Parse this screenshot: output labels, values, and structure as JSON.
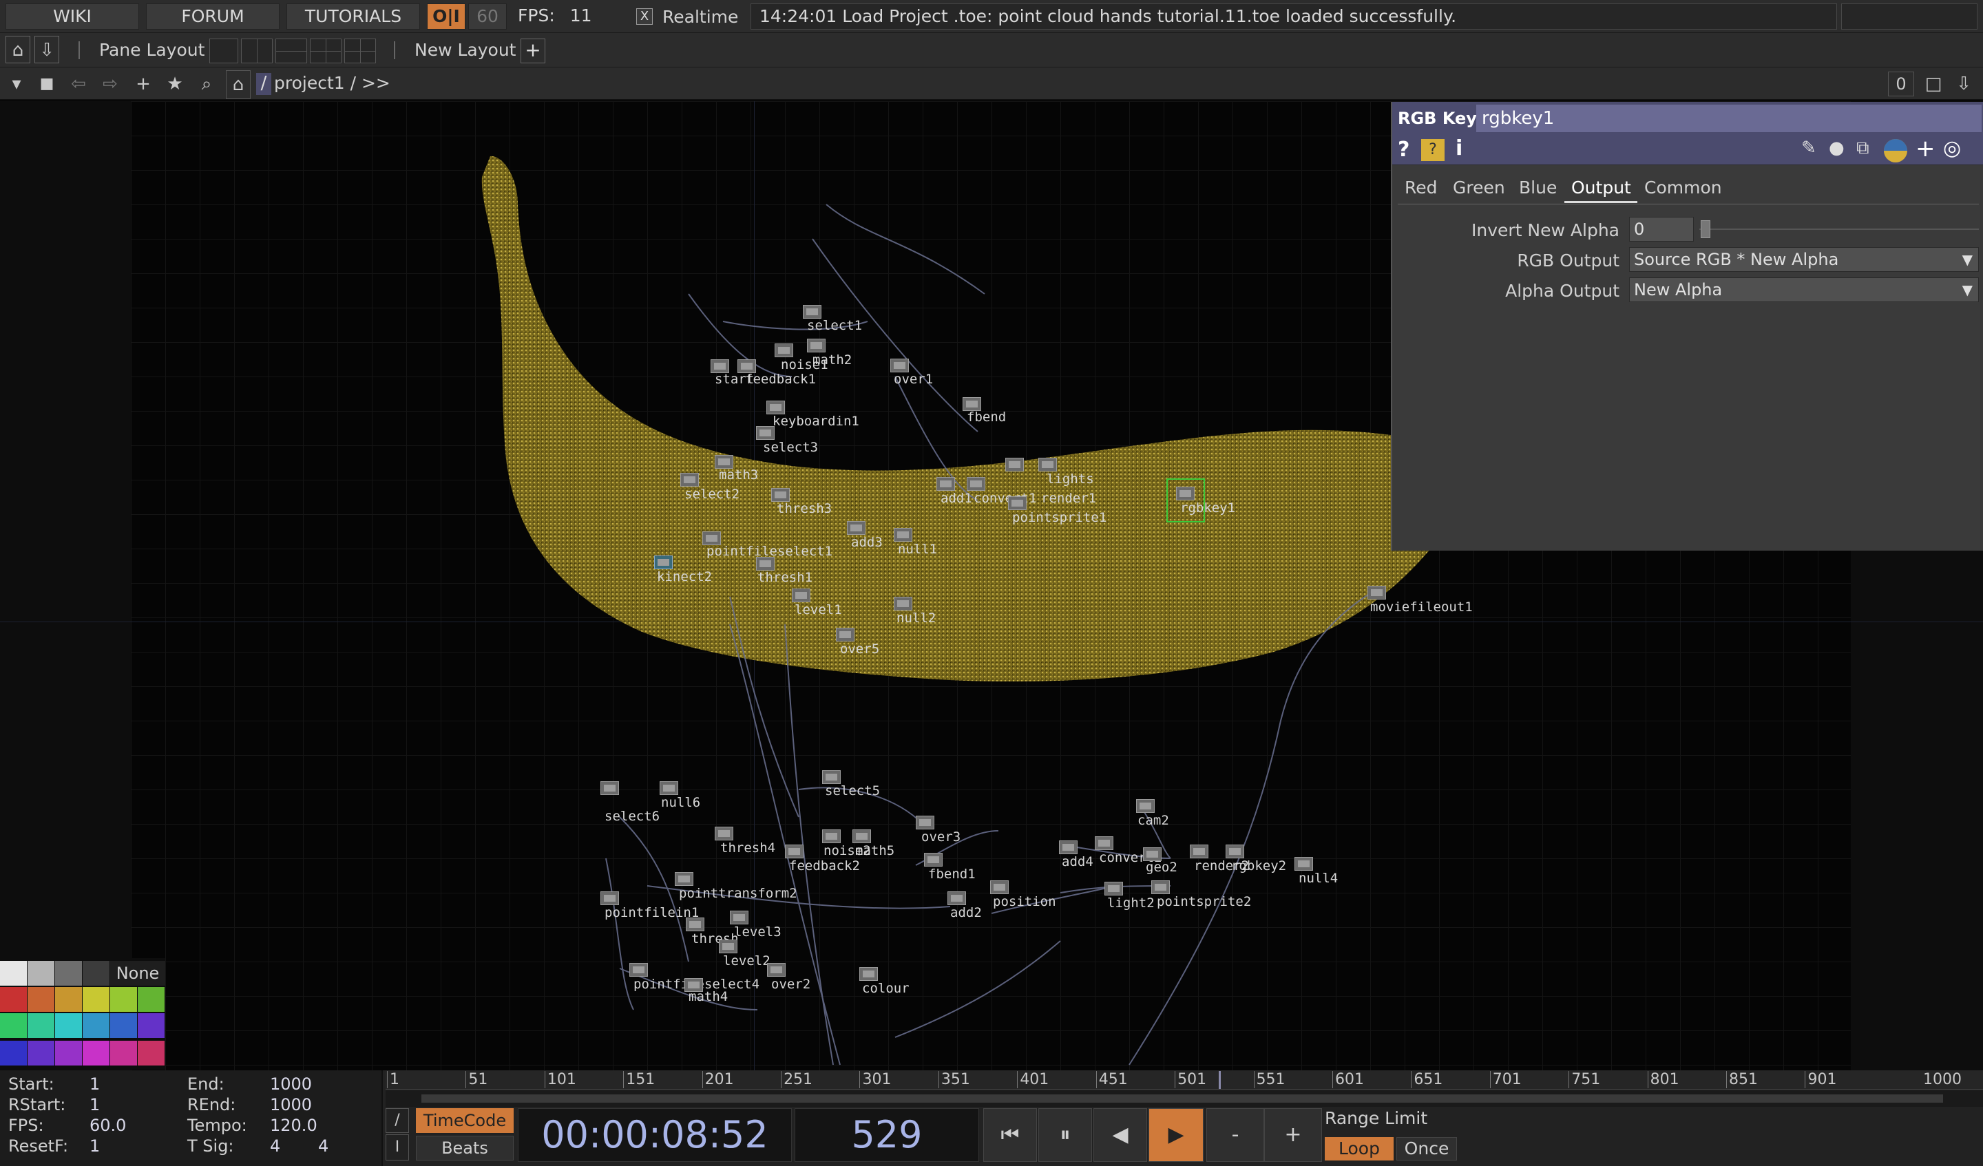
{
  "topbar": {
    "wiki": "WIKI",
    "forum": "FORUM",
    "tutorials": "TUTORIALS",
    "oi": "O|I",
    "sixty": "60",
    "fps_label": "FPS:",
    "fps_value": "11",
    "realtime_check": "X",
    "realtime_label": "Realtime",
    "status": "14:24:01 Load Project .toe: point cloud hands tutorial.11.toe loaded successfully."
  },
  "bar2": {
    "pane_layout": "Pane Layout",
    "new_layout": "New Layout",
    "plus": "+"
  },
  "bar3": {
    "slash": "/",
    "path": "project1 / >>",
    "counter": "0"
  },
  "network": {
    "nodes": [
      {
        "name": "select1"
      },
      {
        "name": "math2"
      },
      {
        "name": "noise1"
      },
      {
        "name": "feedback1"
      },
      {
        "name": "start"
      },
      {
        "name": "over1"
      },
      {
        "name": "fbend"
      },
      {
        "name": "keyboardin1"
      },
      {
        "name": "select3"
      },
      {
        "name": "math3"
      },
      {
        "name": "select2"
      },
      {
        "name": "thresh3"
      },
      {
        "name": "add3"
      },
      {
        "name": "null1"
      },
      {
        "name": "pointfileselect1"
      },
      {
        "name": "thresh1"
      },
      {
        "name": "kinect2"
      },
      {
        "name": "level1"
      },
      {
        "name": "null2"
      },
      {
        "name": "over5"
      },
      {
        "name": "add1"
      },
      {
        "name": "convert1"
      },
      {
        "name": "render1"
      },
      {
        "name": "lights"
      },
      {
        "name": "pointsprite1"
      },
      {
        "name": "rgbkey1"
      },
      {
        "name": "moviefileout1"
      },
      {
        "name": "select5"
      },
      {
        "name": "select6"
      },
      {
        "name": "null6"
      },
      {
        "name": "thresh4"
      },
      {
        "name": "over3"
      },
      {
        "name": "noise2"
      },
      {
        "name": "math5"
      },
      {
        "name": "feedback2"
      },
      {
        "name": "fbend1"
      },
      {
        "name": "pointtransform2"
      },
      {
        "name": "position"
      },
      {
        "name": "add2"
      },
      {
        "name": "pointfilein1"
      },
      {
        "name": "thresh"
      },
      {
        "name": "level3"
      },
      {
        "name": "level2"
      },
      {
        "name": "pointfileselect4"
      },
      {
        "name": "math4"
      },
      {
        "name": "over2"
      },
      {
        "name": "colour"
      },
      {
        "name": "cam2"
      },
      {
        "name": "add4"
      },
      {
        "name": "convert2"
      },
      {
        "name": "geo2"
      },
      {
        "name": "render2"
      },
      {
        "name": "rgbkey2"
      },
      {
        "name": "null4"
      },
      {
        "name": "light2"
      },
      {
        "name": "pointsprite2"
      }
    ]
  },
  "param": {
    "type": "RGB Key",
    "name": "rgbkey1",
    "tabs": [
      "Red",
      "Green",
      "Blue",
      "Output",
      "Common"
    ],
    "active_tab": "Output",
    "invert_label": "Invert New Alpha",
    "invert_value": "0",
    "rgb_output_label": "RGB Output",
    "rgb_output_value": "Source RGB * New Alpha",
    "alpha_output_label": "Alpha Output",
    "alpha_output_value": "New Alpha",
    "icons": [
      "help-icon",
      "python-help-icon",
      "info-icon",
      "pencil-icon",
      "comment-icon",
      "clone-icon",
      "python-icon",
      "plus-icon",
      "target-icon"
    ]
  },
  "palette": {
    "none_label": "None",
    "rows": [
      [
        "#e6e6e6",
        "#b4b4b4",
        "#6e6e6e",
        "#3c3c3c"
      ],
      [
        "#c83232",
        "#c86432",
        "#c8962f",
        "#c8c832",
        "#96c832",
        "#64b432"
      ],
      [
        "#32c864",
        "#32c896",
        "#32c8c8",
        "#3296c8",
        "#3264c8",
        "#6432c8"
      ],
      [
        "#3232c8",
        "#6432c8",
        "#9632c8",
        "#c832c8",
        "#c83296",
        "#c83264"
      ]
    ]
  },
  "timeline": {
    "start_label": "Start:",
    "start": "1",
    "rstart_label": "RStart:",
    "rstart": "1",
    "fps_label": "FPS:",
    "fps": "60.0",
    "resetf_label": "ResetF:",
    "resetf": "1",
    "end_label": "End:",
    "end": "1000",
    "rend_label": "REnd:",
    "rend": "1000",
    "tempo_label": "Tempo:",
    "tempo": "120.0",
    "tsig_label": "T Sig:",
    "tsig_a": "4",
    "tsig_b": "4",
    "ticks": [
      "1",
      "51",
      "101",
      "151",
      "201",
      "251",
      "301",
      "351",
      "401",
      "451",
      "501",
      "551",
      "601",
      "651",
      "701",
      "751",
      "801",
      "851",
      "901",
      "1000"
    ],
    "current_frame_marker": 529,
    "timecode_btn": "TimeCode",
    "beats_btn": "Beats",
    "timecode": "00:00:08:52",
    "frame": "529",
    "range_limit": "Range Limit",
    "loop": "Loop",
    "once": "Once",
    "minus": "-",
    "plus": "+"
  }
}
